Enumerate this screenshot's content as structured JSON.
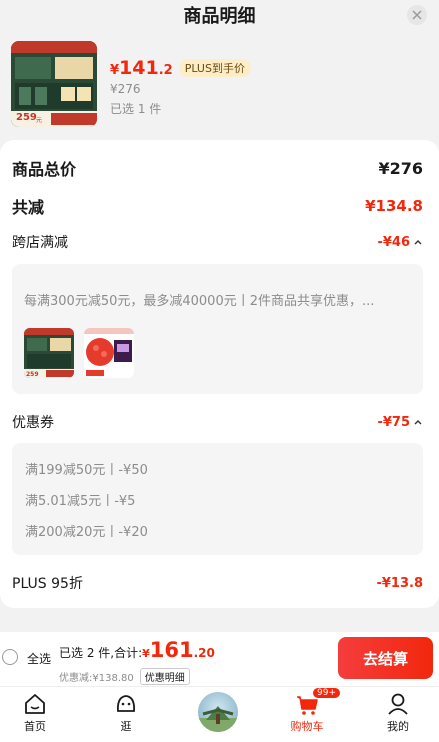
{
  "header": {
    "title": "商品明细"
  },
  "product": {
    "price_yen": "¥",
    "price_int": "141",
    "price_dec": ".2",
    "plus_badge": "PLUS到手价",
    "original_price": "¥276",
    "selected": "已选 1 件",
    "thumb_price": "259",
    "thumb_price_unit": "元"
  },
  "summary": {
    "total_label": "商品总价",
    "total_value": "¥276",
    "reduce_label": "共减",
    "reduce_value": "¥134.8",
    "cross_store_label": "跨店满减",
    "cross_store_value": "-¥46",
    "cross_store_desc": "每满300元减50元，最多减40000元丨2件商品共享优惠，...",
    "coupon_label": "优惠券",
    "coupon_value": "-¥75",
    "coupons": [
      "满199减50元丨-¥50",
      "满5.01减5元丨-¥5",
      "满200减20元丨-¥20"
    ],
    "plus_label": "PLUS 95折",
    "plus_value": "-¥13.8"
  },
  "bottom": {
    "select_all": "全选",
    "selected_total_label": "已选 2 件,合计:",
    "total_yen": "¥",
    "total_int": "161",
    "total_dec": ".20",
    "discount_label": "优惠减:¥138.80",
    "detail_tag": "优惠明细",
    "checkout": "去结算"
  },
  "tabs": [
    {
      "label": "首页",
      "icon": "home-icon"
    },
    {
      "label": "逛",
      "icon": "stroll-icon"
    },
    {
      "label": "",
      "icon": "center-avatar"
    },
    {
      "label": "购物车",
      "icon": "cart-icon",
      "badge": "99+"
    },
    {
      "label": "我的",
      "icon": "profile-icon"
    }
  ],
  "colors": {
    "accent": "#f2270c",
    "plus_bg": "#fdeec7"
  }
}
